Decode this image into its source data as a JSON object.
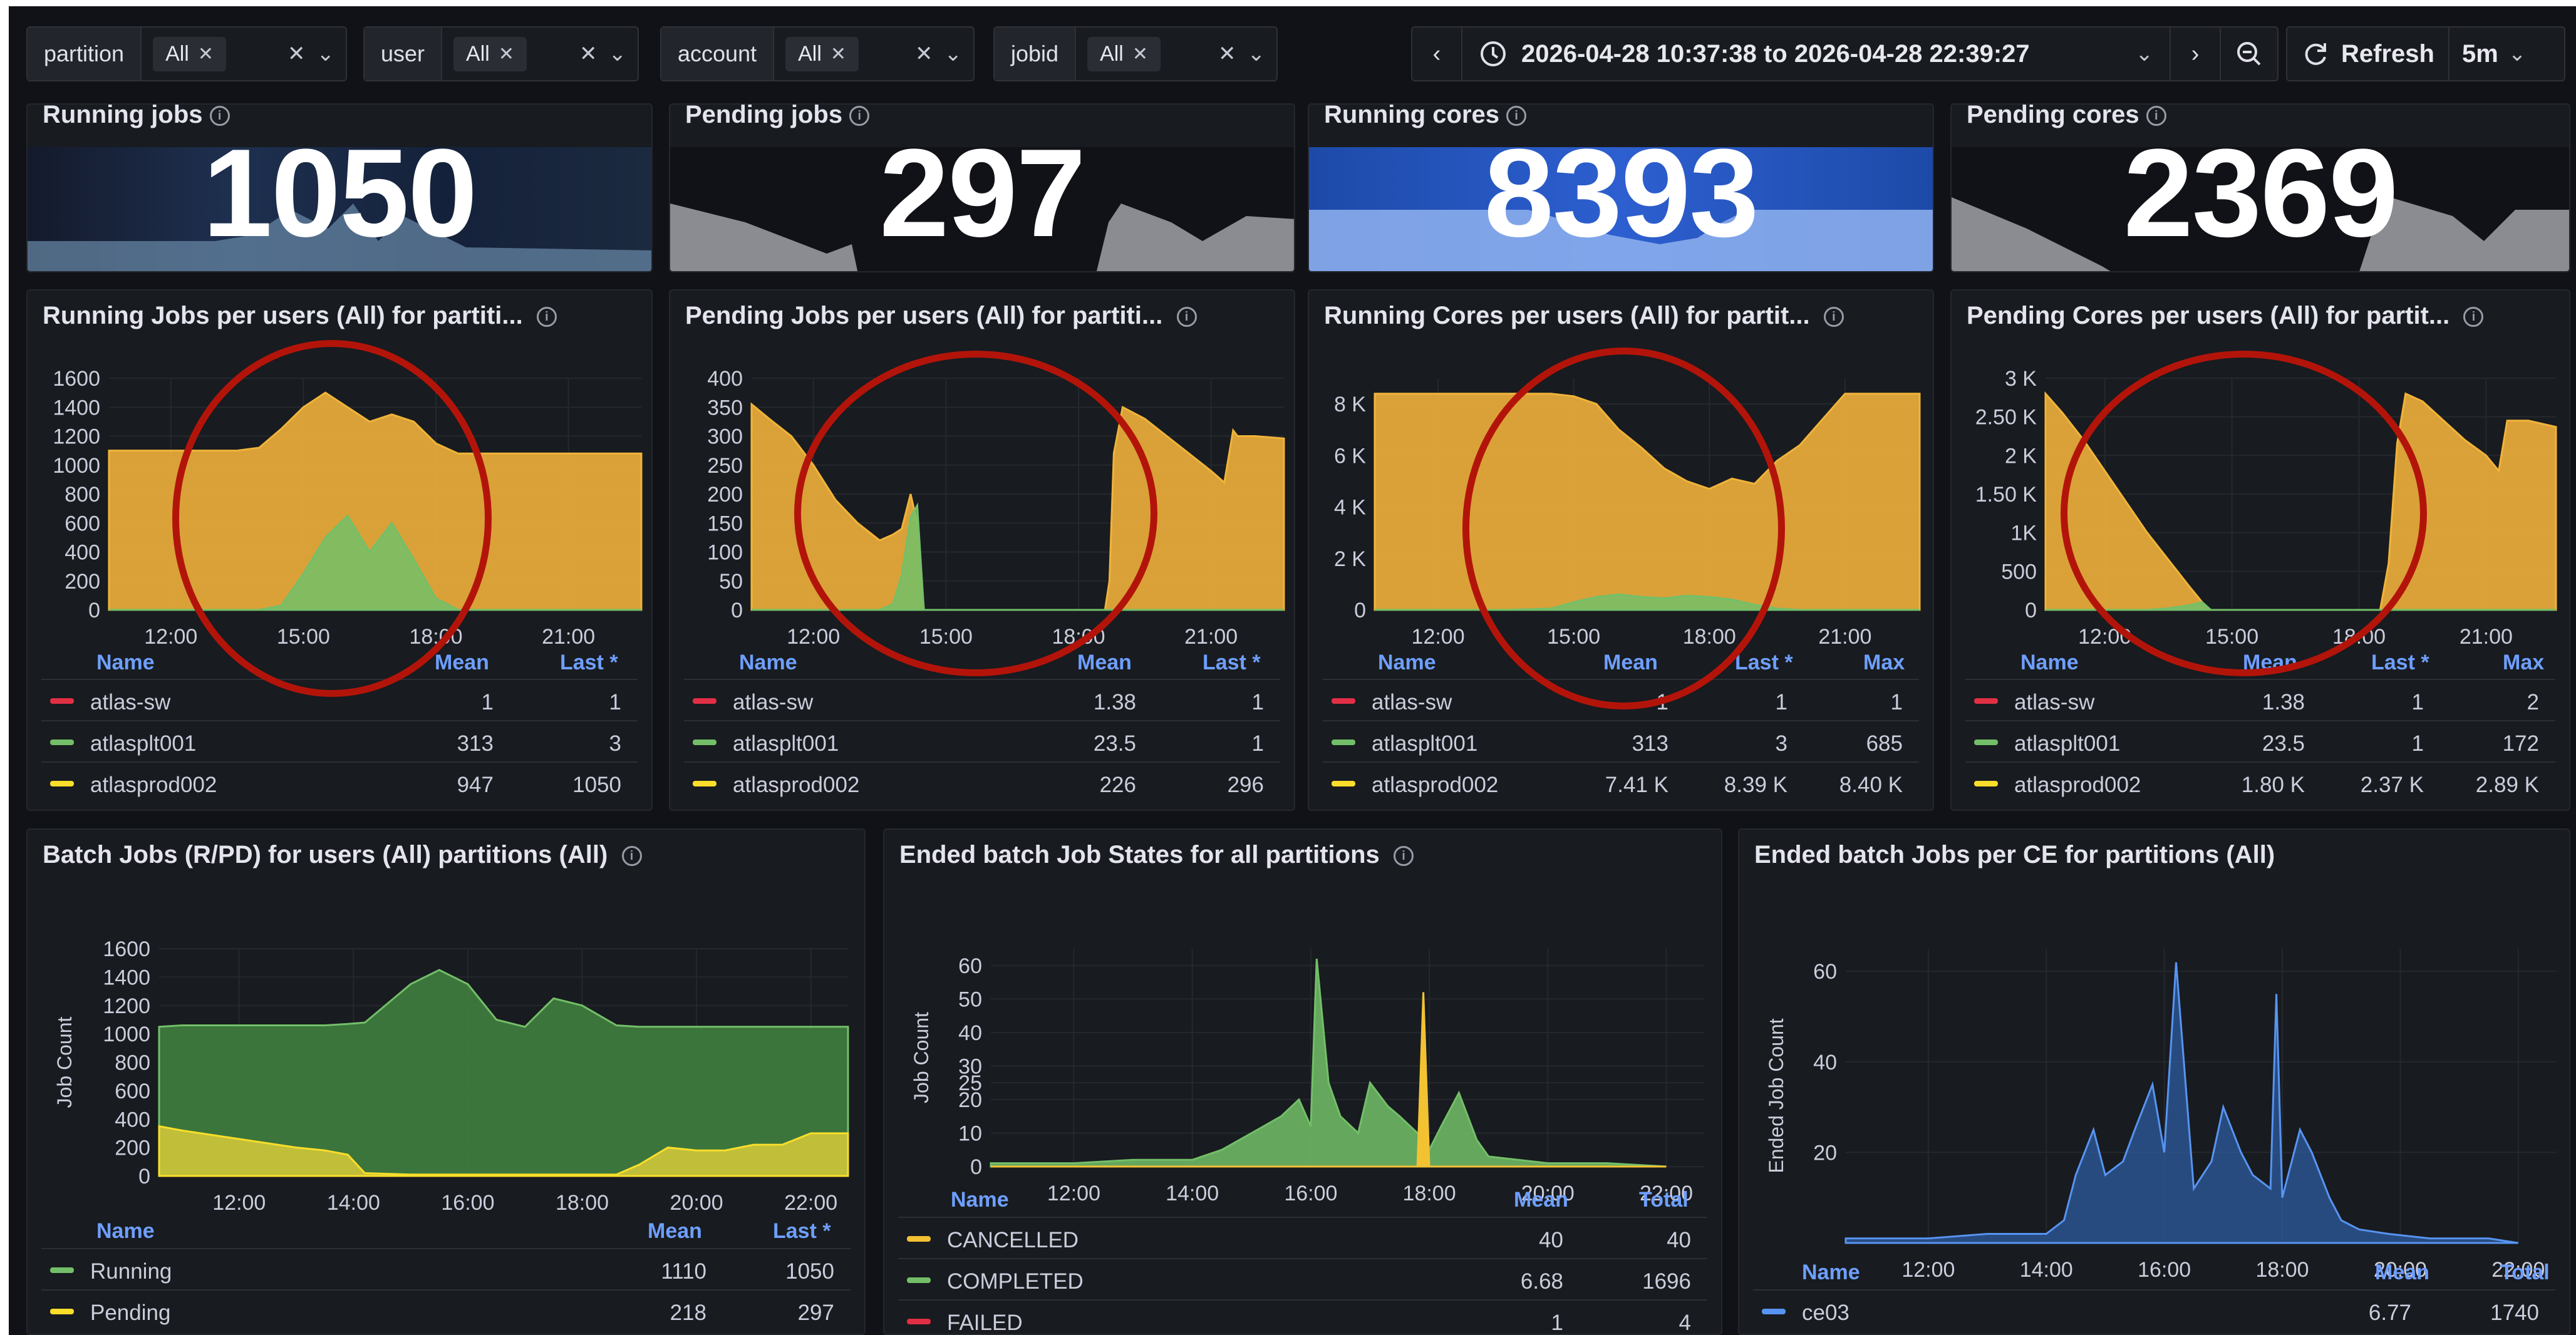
{
  "variables": [
    {
      "label": "partition",
      "value": "All"
    },
    {
      "label": "user",
      "value": "All"
    },
    {
      "label": "account",
      "value": "All"
    },
    {
      "label": "jobid",
      "value": "All"
    }
  ],
  "time_range": "2026-04-28 10:37:38 to 2026-04-28 22:39:27",
  "refresh_label": "Refresh",
  "refresh_interval": "5m",
  "stats": [
    {
      "title": "Running jobs",
      "value": "1050",
      "bg": "#1d2233"
    },
    {
      "title": "Pending jobs",
      "value": "297",
      "bg": "#111217"
    },
    {
      "title": "Running cores",
      "value": "8393",
      "bg": "#2f5fc8"
    },
    {
      "title": "Pending cores",
      "value": "2369",
      "bg": "#111217"
    }
  ],
  "panels": {
    "running_jobs": {
      "title": "Running Jobs per users (All) for partiti...",
      "legend_headers": {
        "name": "Name",
        "mean": "Mean",
        "last": "Last *"
      },
      "rows": [
        {
          "name": "atlas-sw",
          "mean": "1",
          "last": "1",
          "color": "#e02f44"
        },
        {
          "name": "atlasplt001",
          "mean": "313",
          "last": "3",
          "color": "#73bf69"
        },
        {
          "name": "atlasprod002",
          "mean": "947",
          "last": "1050",
          "color": "#fade2a"
        }
      ]
    },
    "pending_jobs": {
      "title": "Pending Jobs per users (All) for partiti...",
      "legend_headers": {
        "name": "Name",
        "mean": "Mean",
        "last": "Last *"
      },
      "rows": [
        {
          "name": "atlas-sw",
          "mean": "1.38",
          "last": "1",
          "color": "#e02f44"
        },
        {
          "name": "atlasplt001",
          "mean": "23.5",
          "last": "1",
          "color": "#73bf69"
        },
        {
          "name": "atlasprod002",
          "mean": "226",
          "last": "296",
          "color": "#fade2a"
        }
      ]
    },
    "running_cores": {
      "title": "Running Cores per users (All) for partit...",
      "legend_headers": {
        "name": "Name",
        "mean": "Mean",
        "last": "Last *",
        "max": "Max"
      },
      "rows": [
        {
          "name": "atlas-sw",
          "mean": "1",
          "last": "1",
          "max": "1",
          "color": "#e02f44"
        },
        {
          "name": "atlasplt001",
          "mean": "313",
          "last": "3",
          "max": "685",
          "color": "#73bf69"
        },
        {
          "name": "atlasprod002",
          "mean": "7.41 K",
          "last": "8.39 K",
          "max": "8.40 K",
          "color": "#fade2a"
        }
      ]
    },
    "pending_cores": {
      "title": "Pending Cores per users (All) for partit...",
      "legend_headers": {
        "name": "Name",
        "mean": "Mean",
        "last": "Last *",
        "max": "Max"
      },
      "rows": [
        {
          "name": "atlas-sw",
          "mean": "1.38",
          "last": "1",
          "max": "2",
          "color": "#e02f44"
        },
        {
          "name": "atlasplt001",
          "mean": "23.5",
          "last": "1",
          "max": "172",
          "color": "#73bf69"
        },
        {
          "name": "atlasprod002",
          "mean": "1.80 K",
          "last": "2.37 K",
          "max": "2.89 K",
          "color": "#fade2a"
        }
      ]
    },
    "batch_jobs": {
      "title": "Batch Jobs (R/PD) for users (All) partitions (All)",
      "legend_headers": {
        "name": "Name",
        "mean": "Mean",
        "last": "Last *"
      },
      "rows": [
        {
          "name": "Running",
          "mean": "1110",
          "last": "1050",
          "color": "#73bf69"
        },
        {
          "name": "Pending",
          "mean": "218",
          "last": "297",
          "color": "#fade2a"
        }
      ]
    },
    "ended_states": {
      "title": "Ended batch Job States for all partitions",
      "legend_headers": {
        "name": "Name",
        "mean": "Mean",
        "total": "Total"
      },
      "rows": [
        {
          "name": "CANCELLED",
          "mean": "40",
          "total": "40",
          "color": "#f2c233"
        },
        {
          "name": "COMPLETED",
          "mean": "6.68",
          "total": "1696",
          "color": "#73bf69"
        },
        {
          "name": "FAILED",
          "mean": "1",
          "total": "4",
          "color": "#e02f44"
        }
      ]
    },
    "ended_ce": {
      "title": "Ended batch Jobs per CE for partitions (All)",
      "legend_headers": {
        "name": "Name",
        "mean": "Mean",
        "total": "Total"
      },
      "rows": [
        {
          "name": "ce03",
          "mean": "6.77",
          "total": "1740",
          "color": "#5794f2"
        }
      ]
    }
  },
  "chart_data": [
    {
      "type": "area",
      "panel": "Running Jobs per users (All) for partiti...",
      "ylim": [
        0,
        1600
      ],
      "y_ticks": [
        "0",
        "200",
        "400",
        "600",
        "800",
        "1000",
        "1200",
        "1400",
        "1600"
      ],
      "x_ticks": [
        "12:00",
        "15:00",
        "18:00",
        "21:00"
      ],
      "x": [
        10.6,
        11.5,
        12.5,
        13.5,
        14.0,
        14.5,
        15.0,
        15.5,
        16.0,
        16.5,
        17.0,
        17.5,
        18.0,
        18.5,
        19.0,
        20.0,
        21.0,
        22.0,
        22.65
      ],
      "series": [
        {
          "name": "atlasplt001",
          "values": [
            0,
            0,
            0,
            0,
            0,
            30,
            250,
            500,
            650,
            400,
            600,
            350,
            80,
            0,
            0,
            0,
            0,
            0,
            0
          ]
        },
        {
          "name": "atlasprod002",
          "values": [
            1100,
            1100,
            1100,
            1100,
            1120,
            1250,
            1400,
            1500,
            1400,
            1300,
            1350,
            1300,
            1150,
            1080,
            1080,
            1080,
            1080,
            1080,
            1080
          ]
        }
      ]
    },
    {
      "type": "area",
      "panel": "Pending Jobs per users (All) for partiti...",
      "ylim": [
        0,
        400
      ],
      "y_ticks": [
        "0",
        "50",
        "100",
        "150",
        "200",
        "250",
        "300",
        "350",
        "400"
      ],
      "x_ticks": [
        "12:00",
        "15:00",
        "18:00",
        "21:00"
      ],
      "x": [
        10.6,
        11.0,
        11.5,
        12.0,
        12.5,
        13.0,
        13.5,
        13.8,
        14.0,
        14.2,
        14.35,
        14.5,
        15.0,
        16.0,
        17.0,
        18.0,
        18.6,
        18.7,
        18.8,
        19.0,
        19.5,
        20.0,
        20.5,
        21.0,
        21.3,
        21.5,
        21.6,
        22.0,
        22.65
      ],
      "series": [
        {
          "name": "atlasplt001",
          "values": [
            0,
            0,
            0,
            0,
            0,
            0,
            0,
            10,
            60,
            160,
            180,
            0,
            0,
            0,
            0,
            0,
            0,
            0,
            0,
            0,
            0,
            0,
            0,
            0,
            0,
            0,
            0,
            0,
            0
          ]
        },
        {
          "name": "atlasprod002",
          "values": [
            355,
            330,
            300,
            250,
            190,
            150,
            120,
            130,
            140,
            200,
            150,
            0,
            0,
            0,
            0,
            0,
            0,
            50,
            270,
            350,
            330,
            300,
            270,
            240,
            220,
            310,
            300,
            300,
            296
          ]
        }
      ]
    },
    {
      "type": "area",
      "panel": "Running Cores per users (All) for partit...",
      "ylim": [
        0,
        9000
      ],
      "y_ticks": [
        "0",
        "2 K",
        "4 K",
        "6 K",
        "8 K"
      ],
      "x_ticks": [
        "12:00",
        "15:00",
        "18:00",
        "21:00"
      ],
      "x": [
        10.6,
        12.0,
        13.5,
        14.5,
        15.0,
        15.5,
        16.0,
        16.5,
        17.0,
        17.5,
        18.0,
        18.5,
        19.0,
        19.5,
        20.0,
        21.0,
        22.0,
        22.65
      ],
      "series": [
        {
          "name": "atlasplt001",
          "values": [
            0,
            0,
            0,
            50,
            300,
            500,
            600,
            500,
            450,
            550,
            500,
            400,
            200,
            50,
            0,
            0,
            0,
            0
          ]
        },
        {
          "name": "atlasprod002",
          "values": [
            8400,
            8400,
            8400,
            8400,
            8300,
            8000,
            7000,
            6300,
            5500,
            5000,
            4700,
            5100,
            4900,
            5800,
            6400,
            8400,
            8400,
            8400
          ]
        }
      ]
    },
    {
      "type": "area",
      "panel": "Pending Cores per users (All) for partit...",
      "ylim": [
        0,
        3000
      ],
      "y_ticks": [
        "0",
        "500",
        "1K",
        "1.50 K",
        "2 K",
        "2.50 K",
        "3 K"
      ],
      "x_ticks": [
        "12:00",
        "15:00",
        "18:00",
        "21:00"
      ],
      "x": [
        10.6,
        11.0,
        11.5,
        12.0,
        12.5,
        13.0,
        13.5,
        14.0,
        14.3,
        14.5,
        15.0,
        16.0,
        17.0,
        18.0,
        18.5,
        18.7,
        18.9,
        19.1,
        19.5,
        20.0,
        20.5,
        21.0,
        21.3,
        21.5,
        22.0,
        22.65
      ],
      "series": [
        {
          "name": "atlasplt001",
          "values": [
            0,
            0,
            0,
            0,
            0,
            0,
            20,
            60,
            100,
            0,
            0,
            0,
            0,
            0,
            0,
            0,
            0,
            0,
            0,
            0,
            0,
            0,
            0,
            0,
            0,
            0
          ]
        },
        {
          "name": "atlasprod002",
          "values": [
            2800,
            2550,
            2200,
            1800,
            1400,
            1000,
            650,
            300,
            100,
            0,
            0,
            0,
            0,
            0,
            0,
            600,
            2150,
            2800,
            2700,
            2450,
            2200,
            2000,
            1800,
            2450,
            2450,
            2369
          ]
        }
      ]
    },
    {
      "type": "area",
      "panel": "Batch Jobs (R/PD) for users (All) partitions (All)",
      "ylabel": "Job Count",
      "ylim": [
        0,
        1600
      ],
      "y_ticks": [
        "0",
        "200",
        "400",
        "600",
        "800",
        "1000",
        "1200",
        "1400",
        "1600"
      ],
      "x_ticks": [
        "12:00",
        "14:00",
        "16:00",
        "18:00",
        "20:00",
        "22:00"
      ],
      "x": [
        10.6,
        11.0,
        12.0,
        13.0,
        13.5,
        13.9,
        14.2,
        15.0,
        15.5,
        16.0,
        16.5,
        17.0,
        17.5,
        18.0,
        18.6,
        19.0,
        19.5,
        20.0,
        20.5,
        21.0,
        21.5,
        22.0,
        22.65
      ],
      "series": [
        {
          "name": "Running",
          "values": [
            1050,
            1060,
            1060,
            1060,
            1060,
            1070,
            1080,
            1350,
            1450,
            1350,
            1100,
            1050,
            1250,
            1200,
            1060,
            1050,
            1050,
            1050,
            1050,
            1050,
            1050,
            1050,
            1050
          ]
        },
        {
          "name": "Pending",
          "values": [
            350,
            320,
            260,
            200,
            180,
            150,
            20,
            10,
            10,
            10,
            10,
            10,
            10,
            10,
            10,
            80,
            200,
            180,
            180,
            220,
            220,
            300,
            300
          ]
        }
      ]
    },
    {
      "type": "bar",
      "panel": "Ended batch Job States for all partitions",
      "ylabel": "Job Count",
      "ylim": [
        0,
        65
      ],
      "y_ticks": [
        "0",
        "10",
        "20",
        "25",
        "30",
        "40",
        "50",
        "60"
      ],
      "x_ticks": [
        "12:00",
        "14:00",
        "16:00",
        "18:00",
        "20:00",
        "22:00"
      ],
      "x": [
        10.6,
        11.0,
        12.0,
        13.0,
        14.0,
        14.5,
        15.0,
        15.5,
        15.8,
        16.0,
        16.1,
        16.3,
        16.5,
        16.8,
        17.0,
        17.3,
        17.5,
        17.8,
        17.9,
        18.0,
        18.2,
        18.5,
        18.8,
        19.0,
        19.5,
        20.0,
        21.0,
        22.0
      ],
      "series": [
        {
          "name": "COMPLETED",
          "values": [
            1,
            1,
            1,
            2,
            2,
            5,
            10,
            15,
            20,
            12,
            62,
            25,
            15,
            10,
            25,
            18,
            15,
            10,
            8,
            5,
            12,
            22,
            8,
            3,
            2,
            1,
            1,
            0
          ]
        },
        {
          "name": "CANCELLED",
          "values": [
            0,
            0,
            0,
            0,
            0,
            0,
            0,
            0,
            0,
            0,
            0,
            0,
            0,
            0,
            0,
            0,
            0,
            0,
            52,
            0,
            0,
            0,
            0,
            0,
            0,
            0,
            0,
            0
          ]
        }
      ]
    },
    {
      "type": "bar",
      "panel": "Ended batch Jobs per CE for partitions (All)",
      "ylabel": "Ended Job Count",
      "ylim": [
        0,
        65
      ],
      "y_ticks": [
        "20",
        "40",
        "60"
      ],
      "x_ticks": [
        "12:00",
        "14:00",
        "16:00",
        "18:00",
        "20:00",
        "22:00"
      ],
      "x": [
        10.6,
        11.0,
        12.0,
        13.0,
        14.0,
        14.3,
        14.5,
        14.8,
        15.0,
        15.3,
        15.5,
        15.8,
        16.0,
        16.2,
        16.5,
        16.8,
        17.0,
        17.3,
        17.5,
        17.8,
        17.9,
        18.0,
        18.3,
        18.5,
        18.8,
        19.0,
        19.3,
        19.8,
        20.5,
        21.5,
        22.0
      ],
      "series": [
        {
          "name": "ce03",
          "values": [
            1,
            1,
            1,
            2,
            2,
            5,
            15,
            25,
            15,
            18,
            25,
            35,
            20,
            62,
            12,
            18,
            30,
            20,
            15,
            12,
            55,
            10,
            25,
            20,
            10,
            5,
            3,
            2,
            1,
            1,
            0
          ]
        }
      ]
    }
  ]
}
